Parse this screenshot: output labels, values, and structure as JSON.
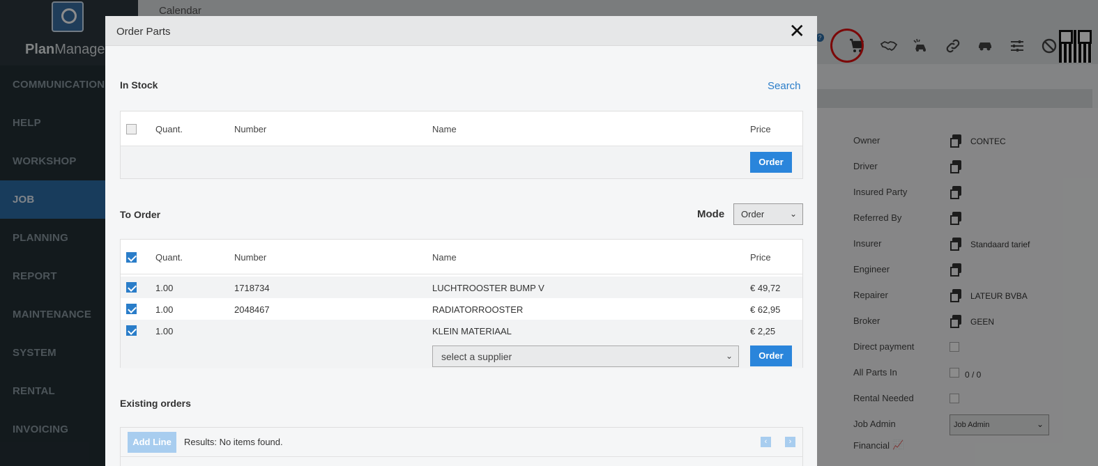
{
  "app": {
    "logo_text_bold": "Plan",
    "logo_text_rest": "Manager",
    "breadcrumb": "Calendar"
  },
  "sidebar": {
    "items": [
      {
        "label": "COMMUNICATION"
      },
      {
        "label": "HELP"
      },
      {
        "label": "WORKSHOP"
      },
      {
        "label": "JOB",
        "active": true
      },
      {
        "label": "PLANNING"
      },
      {
        "label": "REPORT"
      },
      {
        "label": "MAINTENANCE"
      },
      {
        "label": "SYSTEM"
      },
      {
        "label": "RENTAL"
      },
      {
        "label": "INVOICING"
      }
    ]
  },
  "toolbar": {
    "icons": [
      "cart-icon",
      "handshake-icon",
      "car-crash-icon",
      "link-icon",
      "car-icon",
      "sliders-icon",
      "ban-icon",
      "qr-code-icon"
    ],
    "highlight_color": "#e01010"
  },
  "properties": {
    "owner_label": "Owner",
    "owner_value": "CONTEC",
    "driver_label": "Driver",
    "insured_label": "Insured Party",
    "referred_label": "Referred By",
    "insurer_label": "Insurer",
    "insurer_value": "Standaard tarief",
    "engineer_label": "Engineer",
    "repairer_label": "Repairer",
    "repairer_value": "LATEUR BVBA",
    "broker_label": "Broker",
    "broker_value": "GEEN",
    "direct_payment_label": "Direct payment",
    "all_parts_label": "All Parts In",
    "all_parts_value": "0 / 0",
    "rental_label": "Rental Needed",
    "job_admin_label": "Job Admin",
    "job_admin_value": "Job Admin",
    "financial_label": "Financial"
  },
  "modal": {
    "title": "Order Parts",
    "close": "✕",
    "in_stock": {
      "title": "In Stock",
      "search_link": "Search",
      "columns": {
        "quant": "Quant.",
        "number": "Number",
        "name": "Name",
        "price": "Price"
      },
      "order_button": "Order"
    },
    "to_order": {
      "title": "To Order",
      "mode_label": "Mode",
      "mode_value": "Order",
      "columns": {
        "quant": "Quant.",
        "number": "Number",
        "name": "Name",
        "price": "Price"
      },
      "rows": [
        {
          "quant": "1.00",
          "number": "1718734",
          "name": "LUCHTROOSTER BUMP V",
          "price": "€ 49,72",
          "checked": true
        },
        {
          "quant": "1.00",
          "number": "2048467",
          "name": "RADIATORROOSTER",
          "price": "€ 62,95",
          "checked": true
        },
        {
          "quant": "1.00",
          "number": "",
          "name": "KLEIN MATERIAAL",
          "price": "€ 2,25",
          "checked": true
        }
      ],
      "supplier_placeholder": "select a supplier",
      "order_button": "Order"
    },
    "existing_orders": {
      "title": "Existing orders",
      "add_line": "Add Line",
      "results": "Results: No items found."
    }
  },
  "colors": {
    "accent": "#2a85db",
    "sidebar_bg": "#243036",
    "active_item": "#2d6da8"
  }
}
